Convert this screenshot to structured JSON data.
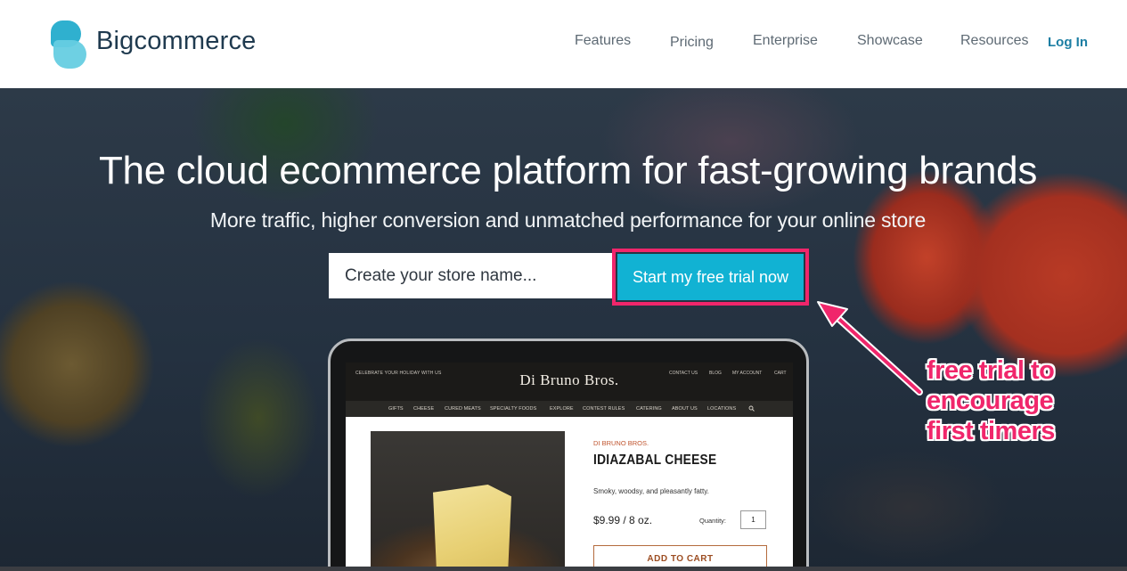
{
  "header": {
    "brand": "Bigcommerce",
    "nav": [
      "Features",
      "Pricing",
      "Enterprise",
      "Showcase",
      "Resources"
    ],
    "login": "Log In"
  },
  "hero": {
    "title": "The cloud ecommerce platform for fast-growing brands",
    "subtitle": "More traffic, higher conversion and unmatched performance for your online store",
    "store_input_placeholder": "Create your store name...",
    "cta": "Start my free trial now"
  },
  "mockup": {
    "promo": "CELEBRATE YOUR HOLIDAY WITH US",
    "store_brand": "Di Bruno Bros.",
    "utility_links": [
      "CONTACT US",
      "BLOG",
      "MY ACCOUNT",
      "CART"
    ],
    "nav": [
      "GIFTS",
      "CHEESE",
      "CURED MEATS",
      "SPECIALTY FOODS",
      "EXPLORE",
      "CONTEST RULES",
      "CATERING",
      "ABOUT US",
      "LOCATIONS"
    ],
    "search_icon": "search-icon",
    "vendor": "DI BRUNO BROS.",
    "product_name": "IDIAZABAL CHEESE",
    "description": "Smoky, woodsy, and pleasantly fatty.",
    "price": "$9.99 / 8 oz.",
    "quantity_label": "Quantity:",
    "quantity": "1",
    "add_to_cart": "ADD TO CART"
  },
  "annotation": {
    "lines": [
      "free trial to",
      "encourage",
      "first timers"
    ],
    "color": "#f0266b"
  },
  "colors": {
    "accent": "#11b2d3",
    "brand_text": "#1f3a4f",
    "login": "#1c7ea3"
  }
}
